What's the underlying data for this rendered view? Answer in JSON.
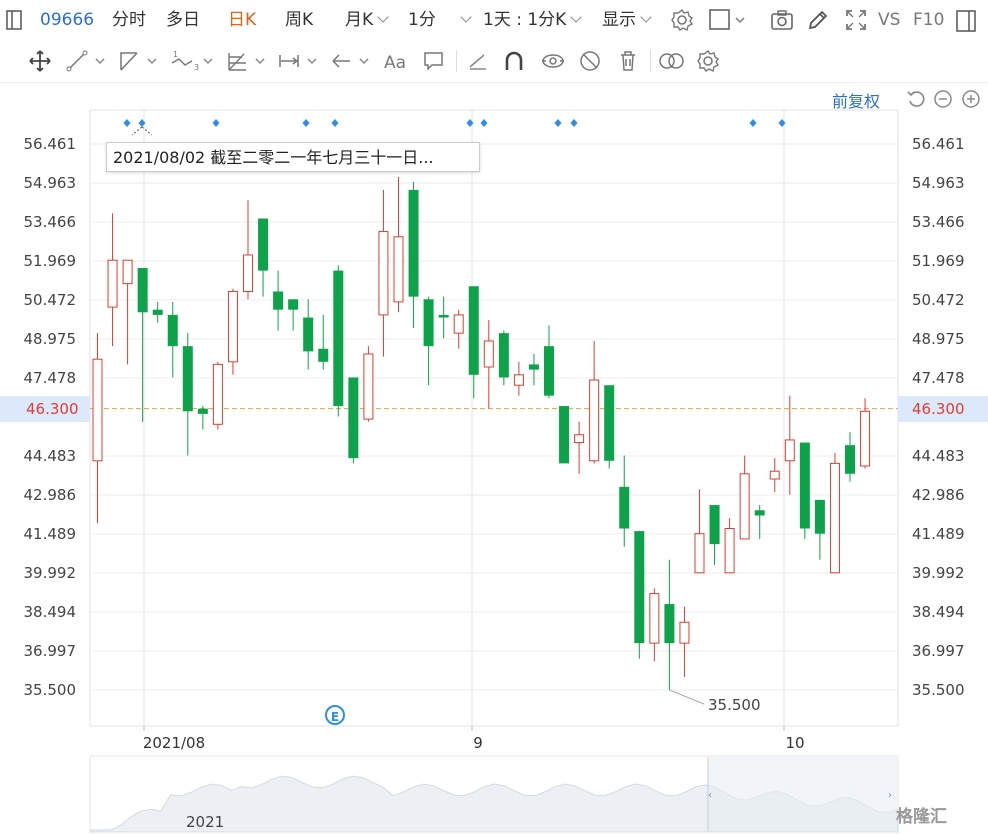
{
  "toolbar": {
    "code": "09666",
    "tabs": [
      "分时",
      "多日",
      "日K",
      "周K",
      "月K"
    ],
    "active_tab": "日K",
    "period": "1分",
    "range": "1天 : 1分K",
    "display": "显示",
    "vs": "VS",
    "f10": "F10"
  },
  "adjust_label": "前复权",
  "tooltip_text": "2021/08/02 截至二零二一年七月三十一日...",
  "current_price_left": "46.300",
  "current_price_right": "46.300",
  "min_label": "35.500",
  "event_badge": "E",
  "nav_year": "2021",
  "watermark": "格隆汇",
  "colors": {
    "up": "#e03c31",
    "down": "#0ea34a",
    "accent": "#2b6fd6",
    "price_line": "#e8a24a"
  },
  "chart_data": {
    "type": "candlestick",
    "x_labels": [
      "2021/08",
      "9",
      "10"
    ],
    "y_ticks": [
      "56.461",
      "54.963",
      "53.466",
      "51.969",
      "50.472",
      "48.975",
      "47.478",
      "46.300",
      "44.483",
      "42.986",
      "41.489",
      "39.992",
      "38.494",
      "36.997",
      "35.500"
    ],
    "ylim": [
      35.5,
      56.461
    ],
    "current_price": 46.3,
    "min_price": 35.5,
    "candles": [
      {
        "o": 44.3,
        "c": 48.2,
        "h": 49.2,
        "l": 41.9,
        "dir": "up"
      },
      {
        "o": 50.2,
        "c": 52.0,
        "h": 53.8,
        "l": 48.7,
        "dir": "up"
      },
      {
        "o": 51.1,
        "c": 52.0,
        "h": 52.0,
        "l": 48.0,
        "dir": "up"
      },
      {
        "o": 51.7,
        "c": 50.0,
        "h": 51.7,
        "l": 45.8,
        "dir": "down"
      },
      {
        "o": 50.1,
        "c": 49.9,
        "h": 50.4,
        "l": 49.6,
        "dir": "down"
      },
      {
        "o": 49.9,
        "c": 48.7,
        "h": 50.4,
        "l": 47.5,
        "dir": "down"
      },
      {
        "o": 48.7,
        "c": 46.2,
        "h": 49.2,
        "l": 44.5,
        "dir": "down"
      },
      {
        "o": 46.3,
        "c": 46.1,
        "h": 46.4,
        "l": 45.5,
        "dir": "down"
      },
      {
        "o": 45.7,
        "c": 48.0,
        "h": 48.1,
        "l": 45.5,
        "dir": "up"
      },
      {
        "o": 48.1,
        "c": 50.8,
        "h": 50.9,
        "l": 47.6,
        "dir": "up"
      },
      {
        "o": 50.8,
        "c": 52.2,
        "h": 54.3,
        "l": 50.5,
        "dir": "up"
      },
      {
        "o": 53.6,
        "c": 51.6,
        "h": 53.6,
        "l": 50.6,
        "dir": "down"
      },
      {
        "o": 50.8,
        "c": 50.1,
        "h": 51.6,
        "l": 49.3,
        "dir": "down"
      },
      {
        "o": 50.5,
        "c": 50.1,
        "h": 50.5,
        "l": 49.3,
        "dir": "down"
      },
      {
        "o": 49.8,
        "c": 48.5,
        "h": 50.5,
        "l": 47.8,
        "dir": "down"
      },
      {
        "o": 48.6,
        "c": 48.1,
        "h": 49.9,
        "l": 47.8,
        "dir": "down"
      },
      {
        "o": 51.6,
        "c": 46.4,
        "h": 51.8,
        "l": 46.0,
        "dir": "down"
      },
      {
        "o": 47.5,
        "c": 44.4,
        "h": 47.5,
        "l": 44.2,
        "dir": "down"
      },
      {
        "o": 45.9,
        "c": 48.4,
        "h": 48.7,
        "l": 45.8,
        "dir": "up"
      },
      {
        "o": 49.9,
        "c": 53.1,
        "h": 54.7,
        "l": 48.3,
        "dir": "up"
      },
      {
        "o": 50.4,
        "c": 52.9,
        "h": 55.2,
        "l": 50.0,
        "dir": "up"
      },
      {
        "o": 54.7,
        "c": 50.6,
        "h": 55.0,
        "l": 49.4,
        "dir": "down"
      },
      {
        "o": 50.5,
        "c": 48.7,
        "h": 50.6,
        "l": 47.2,
        "dir": "down"
      },
      {
        "o": 49.9,
        "c": 49.8,
        "h": 50.6,
        "l": 49.0,
        "dir": "down"
      },
      {
        "o": 49.2,
        "c": 49.9,
        "h": 50.1,
        "l": 48.6,
        "dir": "up"
      },
      {
        "o": 51.0,
        "c": 47.6,
        "h": 51.0,
        "l": 46.7,
        "dir": "down"
      },
      {
        "o": 47.9,
        "c": 48.9,
        "h": 49.7,
        "l": 46.3,
        "dir": "up"
      },
      {
        "o": 49.2,
        "c": 47.5,
        "h": 49.3,
        "l": 47.2,
        "dir": "down"
      },
      {
        "o": 47.2,
        "c": 47.6,
        "h": 48.1,
        "l": 46.8,
        "dir": "up"
      },
      {
        "o": 48.0,
        "c": 47.8,
        "h": 48.4,
        "l": 47.2,
        "dir": "down"
      },
      {
        "o": 48.7,
        "c": 46.8,
        "h": 49.5,
        "l": 46.7,
        "dir": "down"
      },
      {
        "o": 46.4,
        "c": 44.2,
        "h": 46.4,
        "l": 44.2,
        "dir": "down"
      },
      {
        "o": 45.0,
        "c": 45.3,
        "h": 45.8,
        "l": 43.8,
        "dir": "up"
      },
      {
        "o": 44.3,
        "c": 47.4,
        "h": 48.9,
        "l": 44.2,
        "dir": "up"
      },
      {
        "o": 47.2,
        "c": 44.3,
        "h": 47.2,
        "l": 44.0,
        "dir": "down"
      },
      {
        "o": 43.3,
        "c": 41.7,
        "h": 44.5,
        "l": 41.0,
        "dir": "down"
      },
      {
        "o": 41.6,
        "c": 37.3,
        "h": 41.6,
        "l": 36.7,
        "dir": "down"
      },
      {
        "o": 37.3,
        "c": 39.2,
        "h": 39.4,
        "l": 36.6,
        "dir": "up"
      },
      {
        "o": 38.8,
        "c": 37.3,
        "h": 40.5,
        "l": 35.5,
        "dir": "down"
      },
      {
        "o": 37.3,
        "c": 38.1,
        "h": 38.7,
        "l": 36.0,
        "dir": "up"
      },
      {
        "o": 40.0,
        "c": 41.5,
        "h": 43.2,
        "l": 40.0,
        "dir": "up"
      },
      {
        "o": 42.6,
        "c": 41.1,
        "h": 42.6,
        "l": 40.3,
        "dir": "down"
      },
      {
        "o": 40.0,
        "c": 41.7,
        "h": 42.1,
        "l": 40.0,
        "dir": "up"
      },
      {
        "o": 41.3,
        "c": 43.8,
        "h": 44.5,
        "l": 41.3,
        "dir": "up"
      },
      {
        "o": 42.4,
        "c": 42.2,
        "h": 42.6,
        "l": 41.3,
        "dir": "down"
      },
      {
        "o": 43.6,
        "c": 43.9,
        "h": 44.4,
        "l": 43.1,
        "dir": "up"
      },
      {
        "o": 44.3,
        "c": 45.1,
        "h": 46.8,
        "l": 43.0,
        "dir": "up"
      },
      {
        "o": 45.0,
        "c": 41.7,
        "h": 45.0,
        "l": 41.3,
        "dir": "down"
      },
      {
        "o": 42.8,
        "c": 41.5,
        "h": 42.8,
        "l": 40.5,
        "dir": "down"
      },
      {
        "o": 40.0,
        "c": 44.2,
        "h": 44.6,
        "l": 40.0,
        "dir": "up"
      },
      {
        "o": 43.8,
        "c": 44.9,
        "h": 45.4,
        "l": 43.5,
        "dir": "down"
      },
      {
        "o": 44.1,
        "c": 46.2,
        "h": 46.7,
        "l": 44.0,
        "dir": "up"
      }
    ]
  }
}
